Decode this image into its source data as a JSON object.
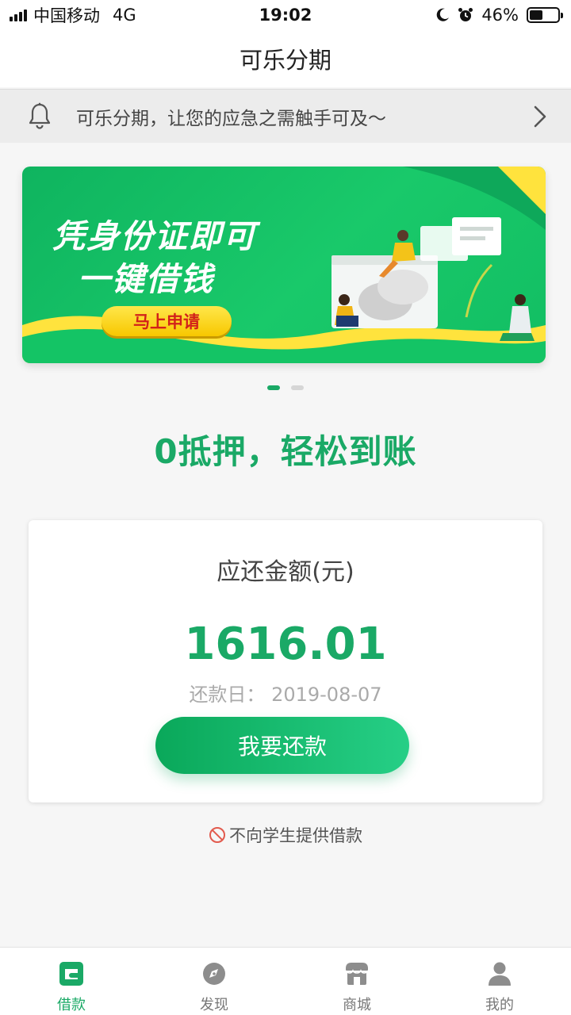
{
  "status_bar": {
    "carrier": "中国移动",
    "network": "4G",
    "time": "19:02",
    "battery": "46%",
    "battery_level": 0.46
  },
  "header": {
    "title": "可乐分期"
  },
  "notice": {
    "text": "可乐分期，让您的应急之需触手可及～"
  },
  "banner": {
    "line1": "凭身份证即可",
    "line2": "一键借钱",
    "cta": "马上申请"
  },
  "carousel": {
    "count": 2,
    "active": 0
  },
  "slogan": "0抵押，轻松到账",
  "card": {
    "title": "应还金额(元)",
    "amount": "1616.01",
    "due_date": "还款日：  2019-08-07",
    "button": "我要还款"
  },
  "student_note": "不向学生提供借款",
  "tabs": [
    {
      "label": "借款",
      "icon": "wallet-icon",
      "active": true
    },
    {
      "label": "发现",
      "icon": "compass-icon",
      "active": false
    },
    {
      "label": "商城",
      "icon": "store-icon",
      "active": false
    },
    {
      "label": "我的",
      "icon": "user-icon",
      "active": false
    }
  ],
  "colors": {
    "accent": "#1aa966",
    "banner_green": "#12be63",
    "cta_yellow": "#f7c700",
    "cta_text": "#d2211a"
  }
}
